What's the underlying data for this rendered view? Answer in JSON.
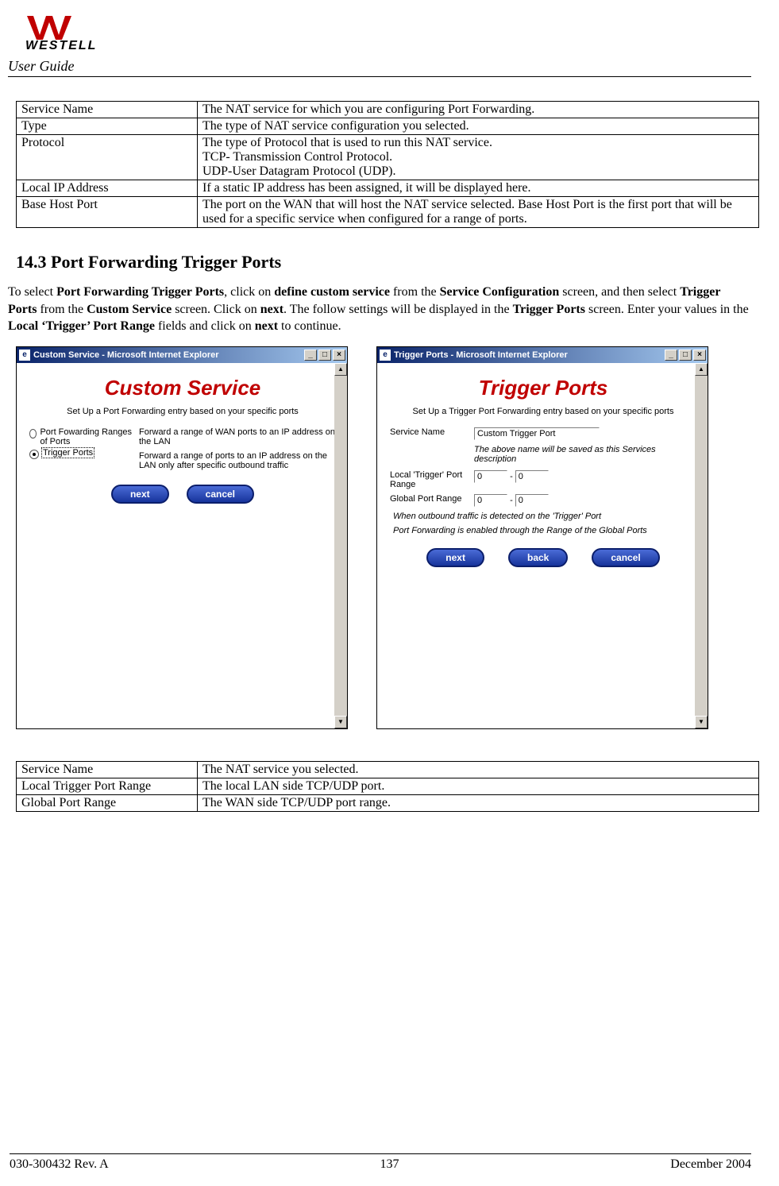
{
  "header": {
    "logo_text": "WESTELL",
    "sub": "User Guide"
  },
  "table1": {
    "rows": [
      {
        "key": "Service Name",
        "val": "The NAT service for which you are configuring Port Forwarding."
      },
      {
        "key": "Type",
        "val": "The type of NAT service configuration you selected."
      },
      {
        "key": "Protocol",
        "val": "The type of Protocol that is used to run this NAT service.\nTCP- Transmission Control Protocol.\nUDP-User Datagram Protocol (UDP)."
      },
      {
        "key": "Local IP Address",
        "val": "If a static IP address has been assigned, it will be displayed here."
      },
      {
        "key": "Base Host Port",
        "val": "The port on the WAN that will host the NAT service selected. Base Host Port is the first port that will be used for a specific service when configured for a range of ports."
      }
    ]
  },
  "section": {
    "number": "14.3",
    "title": "Port Forwarding Trigger Ports",
    "body_plain": "To select Port Forwarding Trigger Ports, click on define custom service from the Service Configuration screen, and then select Trigger Ports from the Custom Service screen. Click on next. The follow settings will be displayed in the Trigger Ports screen. Enter your values in the Local 'Trigger' Port Range fields and click on next to continue."
  },
  "dlg_left": {
    "window_title": "Custom Service - Microsoft Internet Explorer",
    "title": "Custom Service",
    "desc": "Set Up a Port Forwarding entry based on your specific ports",
    "opt1_label": "Port Fowarding Ranges of Ports",
    "opt1_desc": "Forward a range of WAN ports to an IP address on the LAN",
    "opt2_label": "Trigger Ports",
    "opt2_desc": "Forward a range of ports to an IP address on the LAN only after specific outbound traffic",
    "btn_next": "next",
    "btn_cancel": "cancel"
  },
  "dlg_right": {
    "window_title": "Trigger Ports - Microsoft Internet Explorer",
    "title": "Trigger Ports",
    "desc": "Set Up a Trigger Port Forwarding entry based on your specific ports",
    "svc_label": "Service Name",
    "svc_value": "Custom Trigger Port",
    "svc_hint": "The above name will be saved as this Services description",
    "local_label": "Local 'Trigger' Port Range",
    "global_label": "Global Port Range",
    "range_from": "0",
    "range_to": "0",
    "hint1": "When outbound traffic is detected on the 'Trigger' Port",
    "hint2": "Port Forwarding is enabled through the Range of the Global Ports",
    "btn_next": "next",
    "btn_back": "back",
    "btn_cancel": "cancel"
  },
  "table2": {
    "rows": [
      {
        "key": "Service Name",
        "val": "The NAT service you selected."
      },
      {
        "key": "Local Trigger Port Range",
        "val": "The local LAN side TCP/UDP port."
      },
      {
        "key": "Global Port Range",
        "val": "The WAN side TCP/UDP port range."
      }
    ]
  },
  "footer": {
    "left": "030-300432 Rev. A",
    "center": "137",
    "right": "December 2004"
  }
}
